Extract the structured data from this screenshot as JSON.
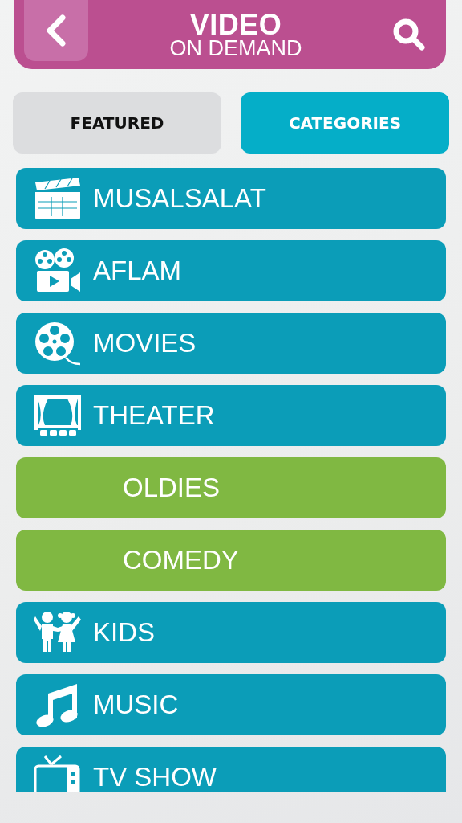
{
  "header": {
    "title": "VIDEO",
    "subtitle": "ON DEMAND"
  },
  "tabs": [
    {
      "label": "FEATURED",
      "selected": false
    },
    {
      "label": "CATEGORIES",
      "selected": true
    }
  ],
  "categories": [
    {
      "label": "MUSALSALAT",
      "kind": "clapperboard",
      "color": "#0b9db8"
    },
    {
      "label": "AFLAM",
      "kind": "camera",
      "color": "#0b9db8"
    },
    {
      "label": "MOVIES",
      "kind": "reel",
      "color": "#0b9db8"
    },
    {
      "label": "THEATER",
      "kind": "stage",
      "color": "#0b9db8"
    },
    {
      "label": "OLDIES",
      "kind": "none",
      "color": "#80b842"
    },
    {
      "label": "COMEDY",
      "kind": "none",
      "color": "#80b842"
    },
    {
      "label": "KIDS",
      "kind": "kids",
      "color": "#0b9db8"
    },
    {
      "label": "MUSIC",
      "kind": "note",
      "color": "#0b9db8"
    },
    {
      "label": "TV SHOW",
      "kind": "tv",
      "color": "#0b9db8"
    }
  ]
}
